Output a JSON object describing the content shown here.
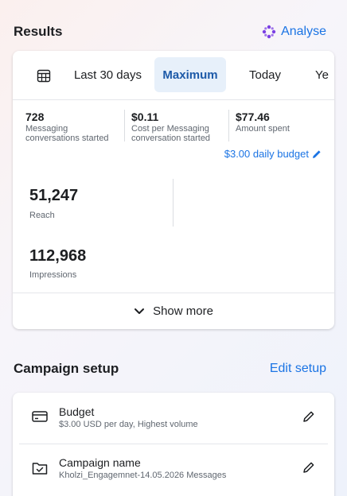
{
  "results": {
    "title": "Results",
    "analyse_label": "Analyse",
    "tabs": [
      "Last 30 days",
      "Maximum",
      "Today",
      "Ye"
    ],
    "metrics": [
      {
        "value": "728",
        "label": "Messaging conversations started"
      },
      {
        "value": "$0.11",
        "label": "Cost per Messaging conversation started"
      },
      {
        "value": "$77.46",
        "label": "Amount spent"
      }
    ],
    "daily_budget": "$3.00 daily budget",
    "reach": {
      "value": "51,247",
      "label": "Reach"
    },
    "impressions": {
      "value": "112,968",
      "label": "Impressions"
    },
    "show_more": "Show more"
  },
  "campaign_setup": {
    "title": "Campaign setup",
    "edit_label": "Edit setup",
    "rows": [
      {
        "title": "Budget",
        "subtitle": "$3.00 USD per day, Highest volume"
      },
      {
        "title": "Campaign name",
        "subtitle": "Kholzi_Engagemnet-14.05.2026 Messages"
      }
    ]
  },
  "colors": {
    "accent": "#1b74e4",
    "active_tab_bg": "#e7f0fa",
    "analyse_icon": "#7b3fe4"
  }
}
